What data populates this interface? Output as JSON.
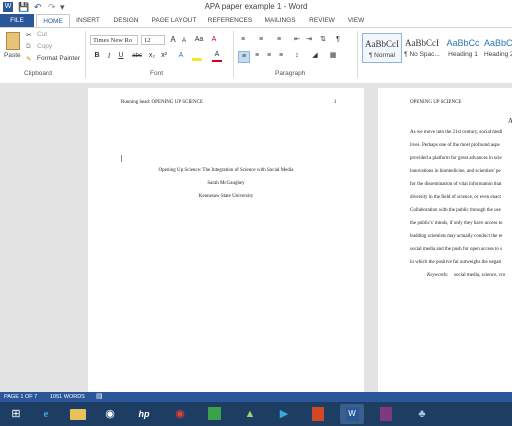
{
  "window": {
    "title": "APA paper example 1 - Word"
  },
  "quick_access": {
    "word_icon": "W",
    "save_icon": "save-icon",
    "undo_icon": "undo-icon",
    "redo_icon": "redo-icon"
  },
  "tabs": [
    {
      "label": "FILE"
    },
    {
      "label": "HOME"
    },
    {
      "label": "INSERT"
    },
    {
      "label": "DESIGN"
    },
    {
      "label": "PAGE LAYOUT"
    },
    {
      "label": "REFERENCES"
    },
    {
      "label": "MAILINGS"
    },
    {
      "label": "REVIEW"
    },
    {
      "label": "VIEW"
    }
  ],
  "clipboard": {
    "paste": "Paste",
    "cut": "Cut",
    "copy": "Copy",
    "format_painter": "Format Painter",
    "group": "Clipboard"
  },
  "font": {
    "name": "Times New Ro",
    "size": "12",
    "bold": "B",
    "italic": "I",
    "underline": "U",
    "strike": "abc",
    "subscript": "x₂",
    "superscript": "x²",
    "clear": "A",
    "grow": "A",
    "shrink": "A",
    "case": "Aa",
    "color": "A",
    "group": "Font"
  },
  "paragraph": {
    "group": "Paragraph",
    "pilcrow": "¶"
  },
  "styles": [
    {
      "sample": "AaBbCcI",
      "name": "¶ Normal"
    },
    {
      "sample": "AaBbCcI",
      "name": "¶ No Spac..."
    },
    {
      "sample": "AaBbCc",
      "name": "Heading 1"
    },
    {
      "sample": "AaBbCc",
      "name": "Heading 2"
    }
  ],
  "page1": {
    "header_left": "Running head: OPENING UP SCIENCE",
    "header_right": "1",
    "title": "Opening Up Science: The Integration of Science with Social Media",
    "author": "Sarah McGaughey",
    "school": "Kennesaw State University"
  },
  "page2": {
    "header_left": "OPENING UP SCIENCE",
    "heading_fragment": "A",
    "lines": [
      "As we move into the 21st century, social medi",
      "lives. Perhaps one of the most profound aspe",
      "provided a platform for great advances in scie",
      "innovations in biomedicine, and scientists' pe",
      "for the dissemination of vital information that",
      "diversity in the field of science, or even enact",
      "Collaboration with the public through the use",
      "the public's' minds, if only they have access to",
      "budding scientists may actually conduct the re",
      "social media and the push for open access to s",
      "in which the positive far outweighs the negati"
    ],
    "keywords_label": "Keywords:",
    "keywords": "social media, science, cro"
  },
  "status": {
    "page": "PAGE 1 OF 7",
    "words": "1051 WORDS"
  },
  "colors": {
    "accent": "#2b579a",
    "taskbar": "#1d3d62"
  }
}
